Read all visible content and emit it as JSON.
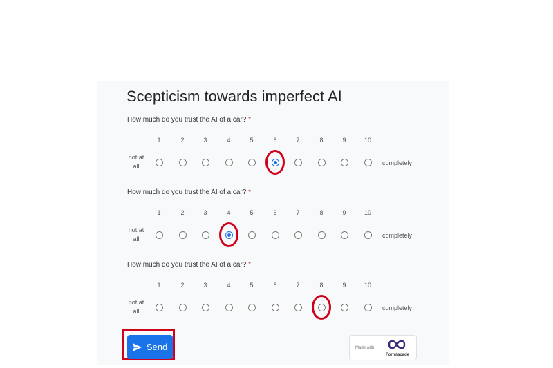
{
  "form": {
    "title": "Scepticism towards imperfect AI",
    "required_marker": "*",
    "questions": [
      {
        "text": "How much do you trust the AI of a car?",
        "scale": [
          "1",
          "2",
          "3",
          "4",
          "5",
          "6",
          "7",
          "8",
          "9",
          "10"
        ],
        "low_label": "not at all",
        "high_label": "completely",
        "selected": "6"
      },
      {
        "text": "How much do you trust the AI of a car?",
        "scale": [
          "1",
          "2",
          "3",
          "4",
          "5",
          "6",
          "7",
          "8",
          "9",
          "10"
        ],
        "low_label": "not at all",
        "high_label": "completely",
        "selected": "4"
      },
      {
        "text": "How much do you trust the AI of a car?",
        "scale": [
          "1",
          "2",
          "3",
          "4",
          "5",
          "6",
          "7",
          "8",
          "9",
          "10"
        ],
        "low_label": "not at all",
        "high_label": "completely",
        "selected": null,
        "highlighted": "8"
      }
    ],
    "submit": {
      "label": "Send",
      "icon": "send-icon"
    },
    "badge": {
      "made_with": "Made with",
      "brand": "Formfacade",
      "icon": "formfacade-logo-icon"
    }
  },
  "colors": {
    "accent": "#1a73e8",
    "annotation": "#d0021b",
    "required": "#dc3545"
  }
}
